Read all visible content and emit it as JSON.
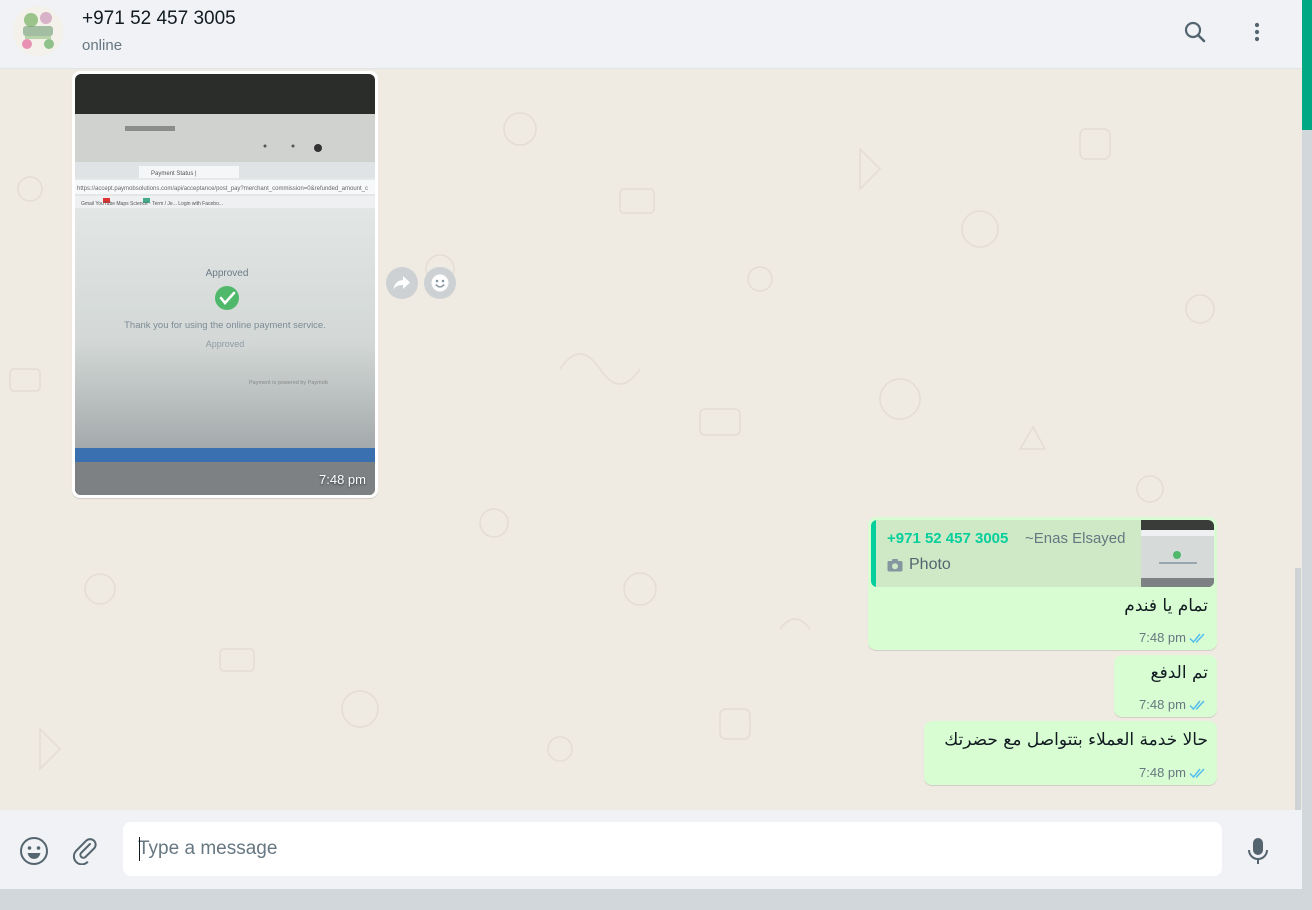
{
  "header": {
    "contact_name": "+971 52 457 3005",
    "status": "online",
    "search_icon": "search-icon",
    "menu_icon": "menu-kebab-icon"
  },
  "messages": {
    "image_message": {
      "time": "7:48 pm",
      "photo_text": {
        "approved_title": "Approved",
        "thanks": "Thank you for using the online payment service.",
        "approved_sub": "Approved",
        "url": "https://accept.paymobsolutions.com/api/acceptance/post_pay?merchant_commission=0&refunded_amount_c",
        "tab_label": "Payment Status |",
        "bookmarks": "Gmail   YouTube   Maps   Science · Term / Je...   Login with Facebo...",
        "powered": "Payment is powered by Paymob"
      },
      "forward_icon": "forward-icon",
      "reaction_icon": "emoji-reaction-icon"
    },
    "reply_message": {
      "quoted_author": "+971 52 457 3005",
      "quoted_pushname": "~Enas Elsayed",
      "quoted_type": "Photo",
      "text": "تمام يا فندم",
      "time": "7:48 pm"
    },
    "msg2": {
      "text": "تم الدفع",
      "time": "7:48 pm"
    },
    "msg3": {
      "text": "حالا خدمة العملاء بتتواصل مع حضرتك",
      "time": "7:48 pm"
    }
  },
  "footer": {
    "placeholder": "Type a message",
    "emoji_icon": "emoji-icon",
    "attach_icon": "paperclip-icon",
    "mic_icon": "microphone-icon"
  },
  "colors": {
    "chat_bg": "#efeae2",
    "outgoing_bubble": "#d9fdd3",
    "accent": "#00a884",
    "quote_author": "#06cf9c",
    "read_ticks": "#53bdeb"
  }
}
